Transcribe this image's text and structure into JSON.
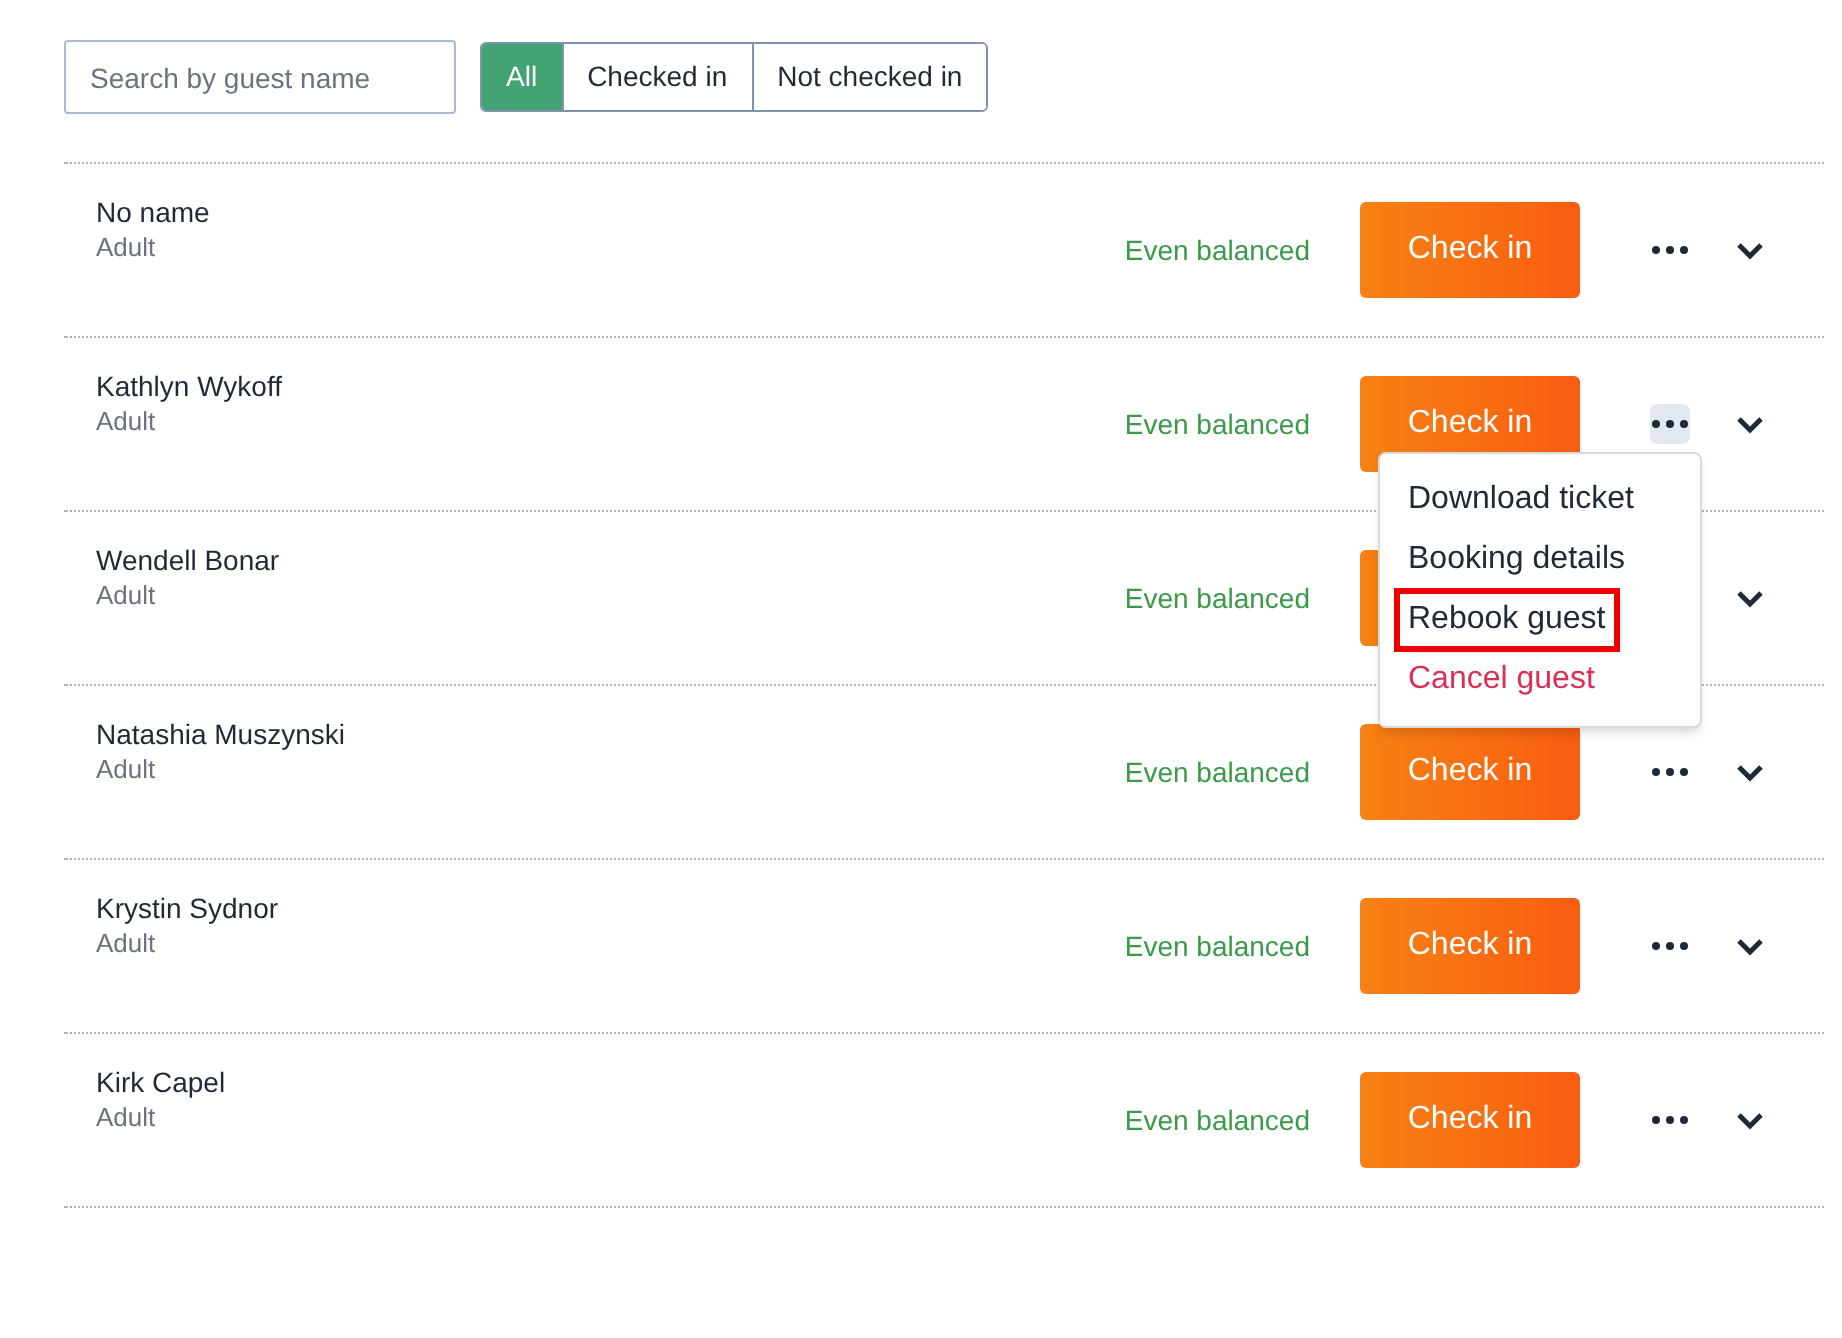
{
  "search": {
    "placeholder": "Search by guest name"
  },
  "filters": [
    {
      "label": "All",
      "selected": true
    },
    {
      "label": "Checked in",
      "selected": false
    },
    {
      "label": "Not checked in",
      "selected": false
    }
  ],
  "guests": [
    {
      "name": "No name",
      "type": "Adult",
      "balance": "Even balanced",
      "action": "Check in",
      "menu_open": false
    },
    {
      "name": "Kathlyn Wykoff",
      "type": "Adult",
      "balance": "Even balanced",
      "action": "Check in",
      "menu_open": true
    },
    {
      "name": "Wendell Bonar",
      "type": "Adult",
      "balance": "Even balanced",
      "menu_open": false
    },
    {
      "name": "Natashia Muszynski",
      "type": "Adult",
      "balance": "Even balanced",
      "action": "Check in",
      "menu_open": false
    },
    {
      "name": "Krystin Sydnor",
      "type": "Adult",
      "balance": "Even balanced",
      "action": "Check in",
      "menu_open": false
    },
    {
      "name": "Kirk Capel",
      "type": "Adult",
      "balance": "Even balanced",
      "action": "Check in",
      "menu_open": false
    }
  ],
  "guest_menu": [
    {
      "label": "Download ticket",
      "kind": "normal",
      "highlighted": false
    },
    {
      "label": "Booking details",
      "kind": "normal",
      "highlighted": false
    },
    {
      "label": "Rebook guest",
      "kind": "normal",
      "highlighted": true
    },
    {
      "label": "Cancel guest",
      "kind": "danger",
      "highlighted": false
    }
  ]
}
